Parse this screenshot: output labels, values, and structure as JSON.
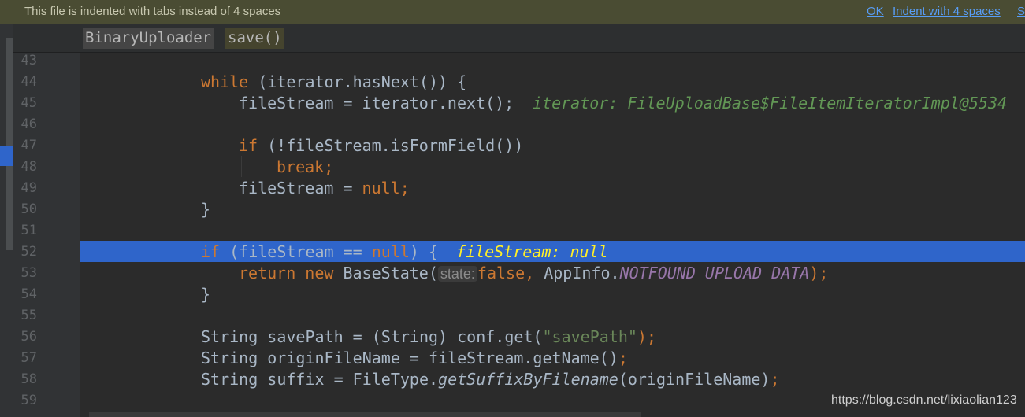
{
  "notification": {
    "message": "This file is indented with tabs instead of 4 spaces",
    "ok": "OK",
    "indent": "Indent with 4 spaces",
    "extra": "S"
  },
  "breadcrumb": {
    "class_name": "BinaryUploader",
    "method_name": "save()"
  },
  "lines": {
    "n43": "43",
    "n44": "44",
    "n45": "45",
    "n46": "46",
    "n47": "47",
    "n48": "48",
    "n49": "49",
    "n50": "50",
    "n51": "51",
    "n52": "52",
    "n53": "53",
    "n54": "54",
    "n55": "55",
    "n56": "56",
    "n57": "57",
    "n58": "58",
    "n59": "59"
  },
  "code": {
    "l44_kw": "while",
    "l44_rest": " (iterator.hasNext()) {",
    "l45_code": "fileStream = iterator.next();",
    "l45_hint": "iterator: FileUploadBase$FileItemIteratorImpl@5534",
    "l47_kw": "if",
    "l47_rest": " (!fileStream.isFormField())",
    "l48_kw": "break;",
    "l49_code": "fileStream = ",
    "l49_kw": "null;",
    "l50": "}",
    "l52_kw": "if",
    "l52_mid": " (fileStream == ",
    "l52_null": "null",
    "l52_end": ") {",
    "l52_hint": "fileStream: null",
    "l53_kw": "return new",
    "l53_cls": " BaseState(",
    "l53_param": "state:",
    "l53_false": "false,",
    "l53_app": " AppInfo.",
    "l53_const": "NOTFOUND_UPLOAD_DATA",
    "l53_end": ");",
    "l54": "}",
    "l56_a": "String savePath = (String) conf.get(",
    "l56_str": "\"savePath\"",
    "l56_end": ");",
    "l57_a": "String originFileName = fileStream.getName()",
    "l57_end": ";",
    "l58_a": "String suffix = FileType.",
    "l58_it": "getSuffixByFilename",
    "l58_b": "(originFileName)",
    "l58_end": ";"
  },
  "watermark": "https://blog.csdn.net/lixiaolian123",
  "colors": {
    "editor_bg": "#2b2b2b",
    "gutter_bg": "#313335",
    "selection": "#2f65ca",
    "keyword": "#cc7832",
    "string": "#6a8759",
    "constant": "#9876aa",
    "debug_hint": "#629755",
    "active_hint": "#ffef28"
  }
}
